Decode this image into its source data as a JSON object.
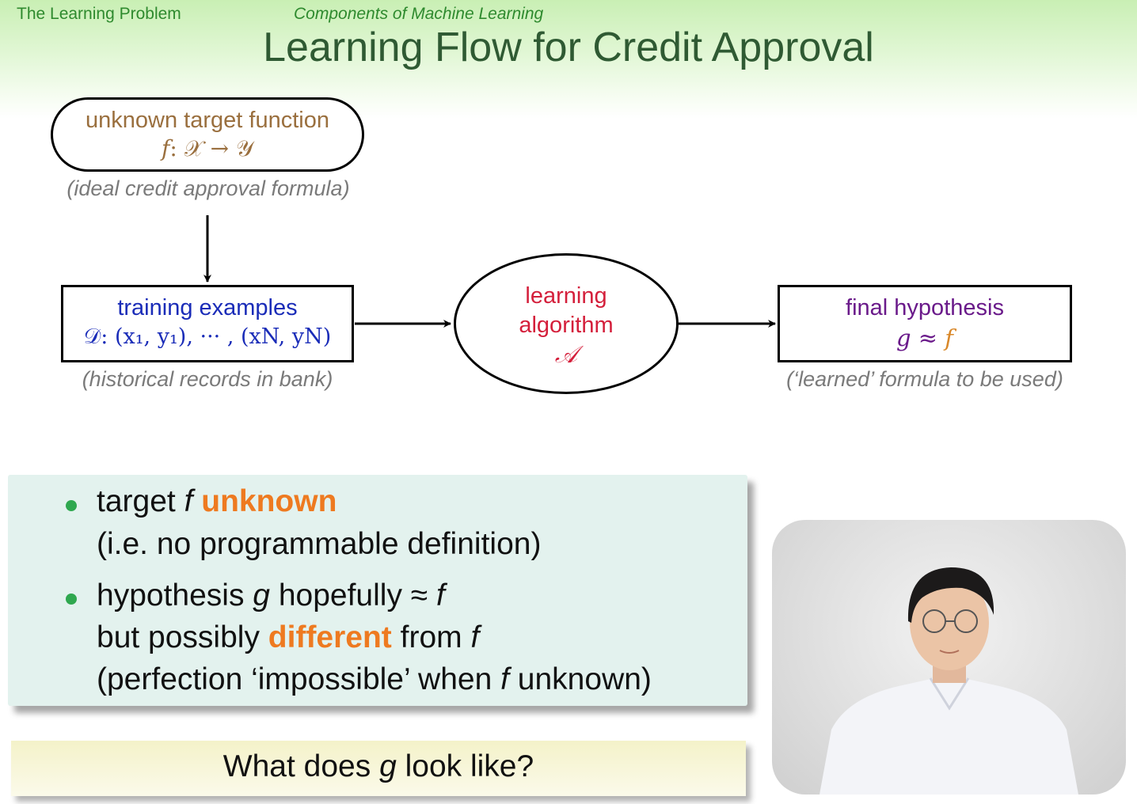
{
  "header": {
    "left": "The Learning Problem",
    "center": "Components of Machine Learning"
  },
  "title": "Learning Flow for Credit Approval",
  "diagram": {
    "target": {
      "label": "unknown target function",
      "formula_f": "f",
      "formula_rest": ": 𝒳 → 𝒴",
      "caption": "(ideal credit approval formula)"
    },
    "training": {
      "label": "training examples",
      "formula": "𝒟: (x₁, y₁), ··· , (xN, yN)",
      "caption": "(historical records in bank)"
    },
    "algorithm": {
      "line1": "learning",
      "line2": "algorithm",
      "symbol": "𝒜"
    },
    "hypothesis": {
      "label": "final hypothesis",
      "formula_g": "g ≈ ",
      "formula_f": "f",
      "caption": "(‘learned’ formula to be used)"
    }
  },
  "bullets": {
    "b1_pre": "target ",
    "b1_f": "f",
    "b1_hl": "unknown",
    "b1_line2": "(i.e. no programmable definition)",
    "b2_pre": "hypothesis ",
    "b2_g": "g",
    "b2_mid": " hopefully ≈ ",
    "b2_f": "f",
    "b2_line2_pre": "but possibly ",
    "b2_line2_hl": "different",
    "b2_line2_post": " from ",
    "b2_line2_f": "f",
    "b2_line3_pre": "(perfection ‘impossible’ when ",
    "b2_line3_f": "f",
    "b2_line3_post": " unknown)"
  },
  "question": {
    "pre": "What does ",
    "g": "g",
    "post": " look like?"
  },
  "colors": {
    "header_green": "#2e8a2e",
    "title_green": "#2f5a33",
    "target_brown": "#9a6f3e",
    "training_blue": "#1a2cb8",
    "algorithm_red": "#d41f3b",
    "hypothesis_purple": "#6a1a8a",
    "highlight_orange": "#ee7a20"
  }
}
